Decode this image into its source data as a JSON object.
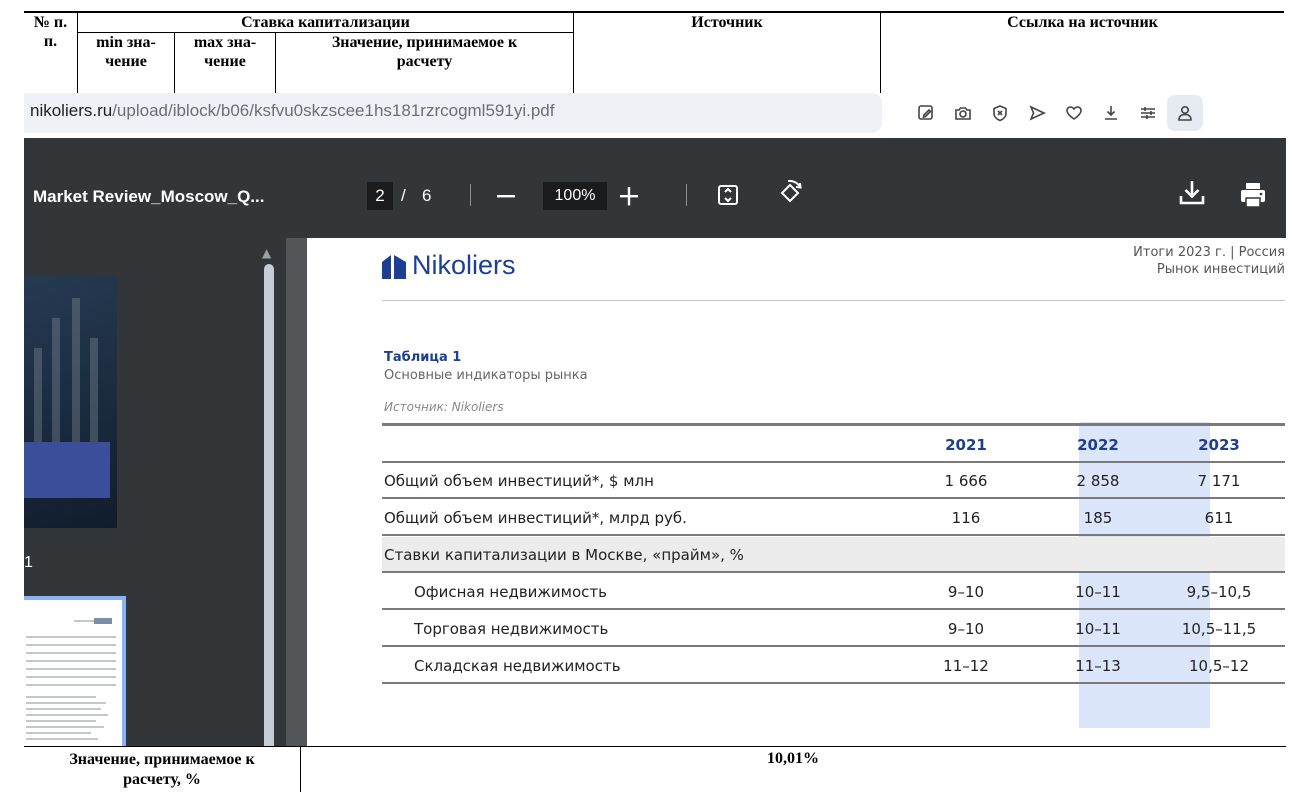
{
  "doc_header": {
    "col_num": "№ п. п.",
    "col_num_line1": "№ п.",
    "col_num_line2": "п.",
    "col_rate_group": "Ставка капитализации",
    "col_min_line1": "min зна-",
    "col_min_line2": "чение",
    "col_max_line1": "max зна-",
    "col_max_line2": "чение",
    "col_value_line1": "Значение, принимаемое к",
    "col_value_line2": "расчету",
    "col_source": "Источник",
    "col_link": "Ссылка на источник"
  },
  "browser": {
    "url_host": "nikoliers.ru",
    "url_path": "/upload/iblock/b06/ksfvu0skzscee1hs181rzrcogml591yi.pdf",
    "icons": [
      "edit-icon",
      "screenshot-icon",
      "block-icon",
      "send-icon",
      "favorite-icon",
      "download-icon",
      "filter-icon",
      "profile-icon"
    ]
  },
  "pdf_toolbar": {
    "title": "Market Review_Moscow_Q...",
    "page_current": "2",
    "page_sep": "/",
    "page_total": "6",
    "zoom": "100%"
  },
  "sidebar": {
    "thumb1_page_number": "1"
  },
  "pdf_page": {
    "logo_text": "Nikoliers",
    "meta_line1": "Итоги 2023 г. | Россия",
    "meta_line2": "Рынок инвестиций",
    "table_title": "Таблица 1",
    "table_subtitle": "Основные индикаторы рынка",
    "table_source": "Источник: Nikoliers",
    "years": [
      "2021",
      "2022",
      "2023"
    ],
    "rows": [
      {
        "label": "Общий объем инвестиций*, $ млн",
        "values": [
          "1 666",
          "2 858",
          "7 171"
        ]
      },
      {
        "label": "Общий объем инвестиций*, млрд руб.",
        "values": [
          "116",
          "185",
          "611"
        ]
      },
      {
        "label": "Ставки капитализации в Москве, «прайм», %",
        "values": [
          "",
          "",
          ""
        ]
      },
      {
        "label": "Офисная недвижимость",
        "values": [
          "9–10",
          "10–11",
          "9,5–10,5"
        ]
      },
      {
        "label": "Торговая недвижимость",
        "values": [
          "9–10",
          "10–11",
          "10,5–11,5"
        ]
      },
      {
        "label": "Складская недвижимость",
        "values": [
          "11–12",
          "11–13",
          "10,5–12"
        ]
      }
    ]
  },
  "doc_footer": {
    "label_line1": "Значение, принимаемое к",
    "label_line2": "расчету, %",
    "value": "10,01%"
  },
  "colors": {
    "brand": "#1c3f94",
    "highlight_2023": "#dce6fb",
    "toolbar_bg": "#323639",
    "viewer_bg": "#525659"
  }
}
